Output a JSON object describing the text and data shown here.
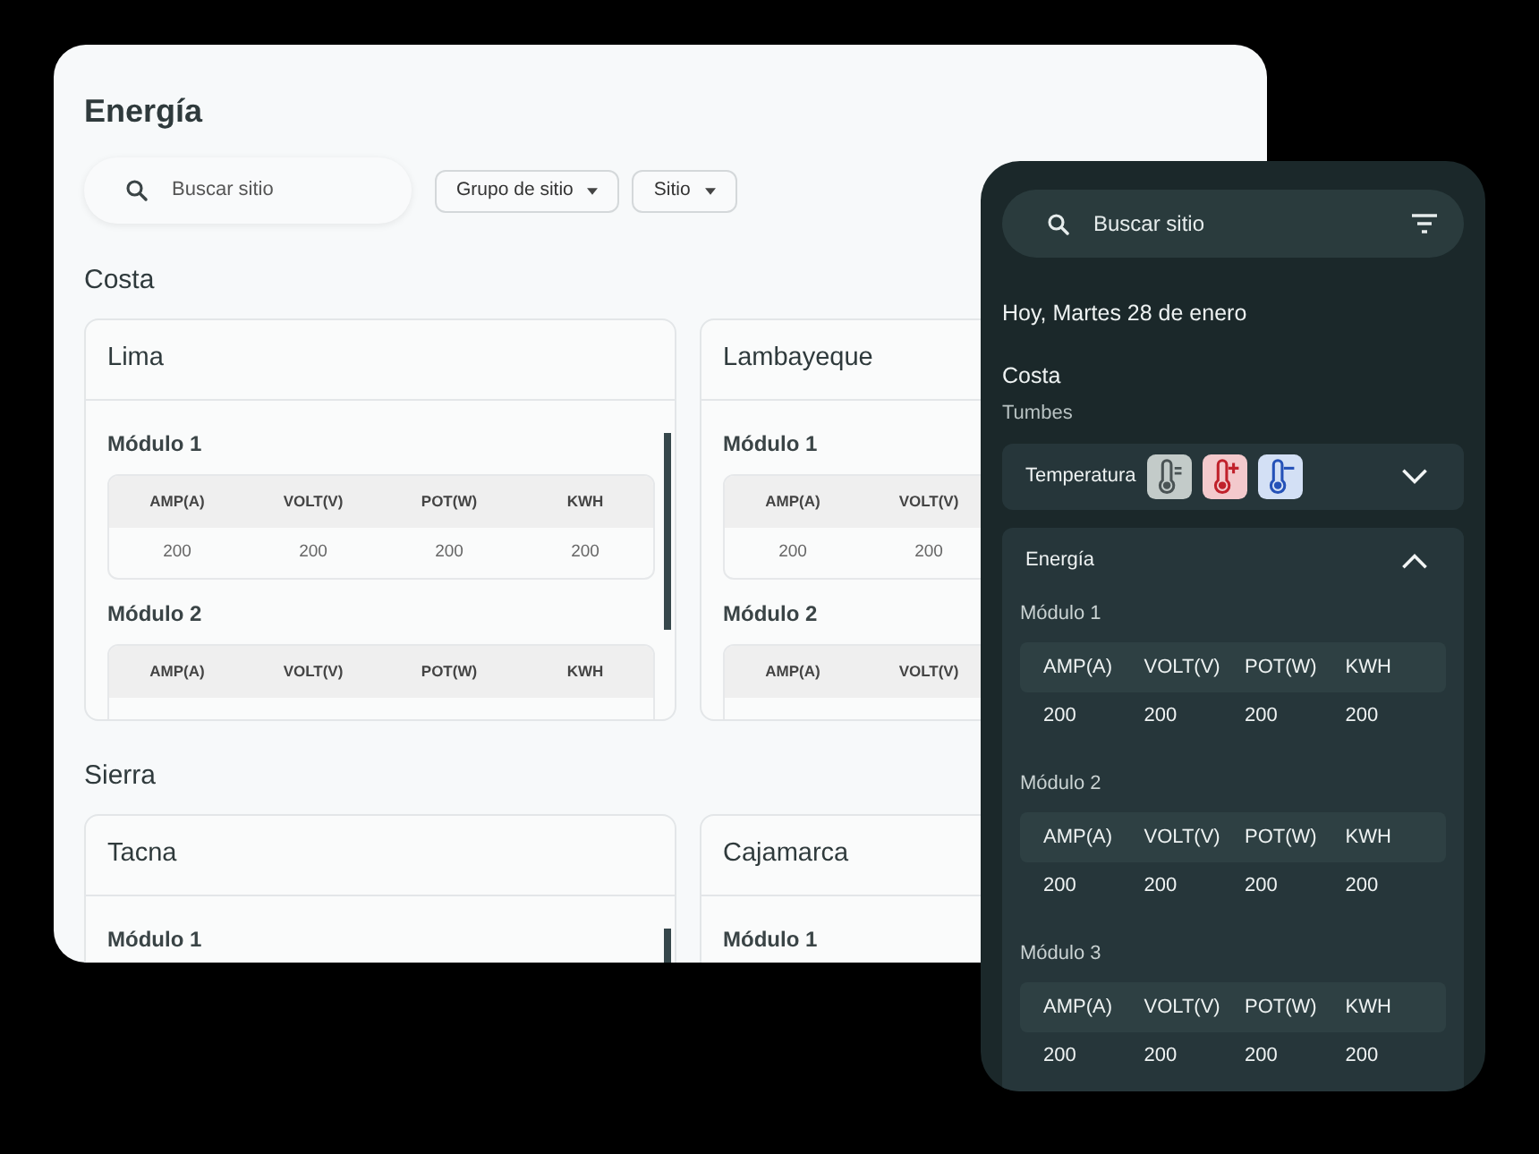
{
  "desktop": {
    "title": "Energía",
    "search": {
      "placeholder": "Buscar sitio"
    },
    "filters": [
      {
        "label": "Grupo de sitio"
      },
      {
        "label": "Sitio"
      }
    ],
    "groups": [
      {
        "name": "Costa",
        "sites": [
          {
            "name": "Lima",
            "modules": [
              {
                "name": "Módulo 1",
                "columns": [
                  "AMP(A)",
                  "VOLT(V)",
                  "POT(W)",
                  "KWH"
                ],
                "values": [
                  "200",
                  "200",
                  "200",
                  "200"
                ]
              },
              {
                "name": "Módulo 2",
                "columns": [
                  "AMP(A)",
                  "VOLT(V)",
                  "POT(W)",
                  "KWH"
                ]
              }
            ]
          },
          {
            "name": "Lambayeque",
            "modules": [
              {
                "name": "Módulo 1",
                "columns": [
                  "AMP(A)",
                  "VOLT(V)"
                ],
                "values": [
                  "200",
                  "200"
                ]
              },
              {
                "name": "Módulo 2",
                "columns": [
                  "AMP(A)",
                  "VOLT(V)"
                ]
              }
            ]
          }
        ]
      },
      {
        "name": "Sierra",
        "sites": [
          {
            "name": "Tacna",
            "modules": [
              {
                "name": "Módulo 1"
              }
            ]
          },
          {
            "name": "Cajamarca",
            "modules": [
              {
                "name": "Módulo 1"
              }
            ]
          }
        ]
      }
    ]
  },
  "mobile": {
    "search": {
      "placeholder": "Buscar sitio"
    },
    "date": "Hoy, Martes 28 de enero",
    "group": "Costa",
    "site": "Tumbes",
    "panels": [
      {
        "kind": "temperature",
        "title": "Temperatura",
        "expanded": false,
        "indicators": [
          {
            "kind": "normal"
          },
          {
            "kind": "high"
          },
          {
            "kind": "low"
          }
        ]
      },
      {
        "kind": "energy",
        "title": "Energía",
        "expanded": true,
        "modules": [
          {
            "name": "Módulo 1",
            "columns": [
              "AMP(A)",
              "VOLT(V)",
              "POT(W)",
              "KWH"
            ],
            "values": [
              "200",
              "200",
              "200",
              "200"
            ]
          },
          {
            "name": "Módulo 2",
            "columns": [
              "AMP(A)",
              "VOLT(V)",
              "POT(W)",
              "KWH"
            ],
            "values": [
              "200",
              "200",
              "200",
              "200"
            ]
          },
          {
            "name": "Módulo 3",
            "columns": [
              "AMP(A)",
              "VOLT(V)",
              "POT(W)",
              "KWH"
            ],
            "values": [
              "200",
              "200",
              "200",
              "200"
            ]
          }
        ]
      }
    ]
  }
}
